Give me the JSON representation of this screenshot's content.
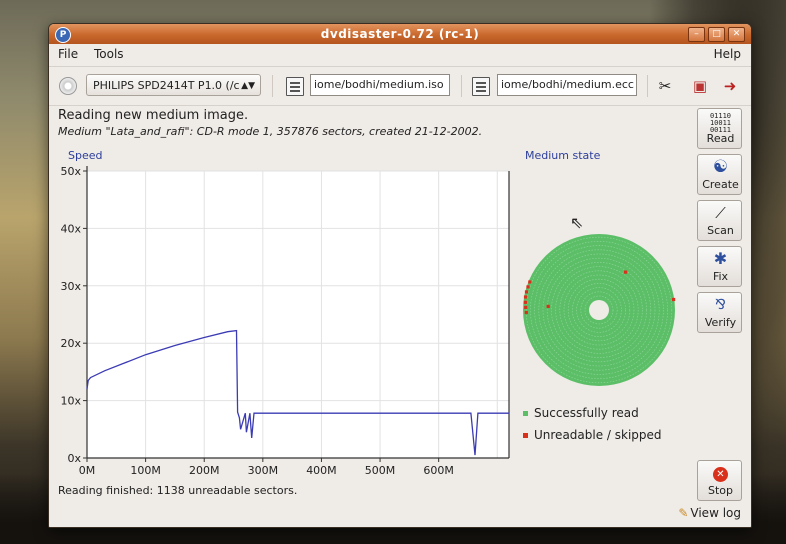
{
  "window": {
    "title": "dvdisaster-0.72 (rc-1)"
  },
  "menu": {
    "file": "File",
    "tools": "Tools",
    "help": "Help"
  },
  "toolbar": {
    "drive": "PHILIPS SPD2414T P1.0 (/c",
    "image_path": "iome/bodhi/medium.iso",
    "ecc_path": "iome/bodhi/medium.ecc"
  },
  "status": {
    "heading": "Reading new medium image.",
    "medium_info": "Medium \"Lata_and_rafi\": CD-R mode 1, 357876 sectors, created 21-12-2002.",
    "finished": "Reading finished: 1138 unreadable sectors."
  },
  "sidebar": {
    "read": "Read",
    "create": "Create",
    "scan": "Scan",
    "fix": "Fix",
    "verify": "Verify",
    "stop": "Stop"
  },
  "bottom": {
    "view_log": "View log"
  },
  "icons": {
    "app": "dvdisaster-icon",
    "drive": "cd-drive-icon",
    "image_file": "image-file-icon",
    "ecc_file": "ecc-file-icon",
    "preferences": "preferences-icon",
    "help": "help-icon",
    "quit": "quit-icon",
    "read": "binary-read-icon",
    "create": "yin-yang-icon",
    "scan": "curve-scan-icon",
    "fix": "puzzle-fix-icon",
    "verify": "checkmark-verify-icon",
    "stop": "stop-icon",
    "log": "log-icon"
  },
  "colors": {
    "speed_line": "#3b3bb5",
    "read_ok": "#5cbf68",
    "unreadable": "#d9301b",
    "axis_label": "#2c3e9b",
    "title_bar": "#c9682c"
  },
  "chart_data": {
    "type": "line",
    "title": "Speed",
    "xlabel": "",
    "ylabel": "",
    "x_unit": "M",
    "xlim": [
      0,
      720
    ],
    "ylim": [
      0,
      50
    ],
    "x_ticks": [
      "0M",
      "100M",
      "200M",
      "300M",
      "400M",
      "500M",
      "600M"
    ],
    "y_ticks": [
      "0x",
      "10x",
      "20x",
      "30x",
      "40x",
      "50x"
    ],
    "grid": true,
    "series": [
      {
        "x": [
          0,
          2,
          6,
          30,
          60,
          100,
          150,
          200,
          240,
          255,
          257,
          260,
          262,
          270,
          272,
          278,
          281,
          285,
          300,
          400,
          500,
          600,
          645,
          655,
          662,
          667,
          674,
          700,
          720
        ],
        "y": [
          12,
          13.5,
          14,
          15.2,
          16.4,
          18,
          19.6,
          21,
          22,
          22.2,
          8,
          7,
          5,
          7.8,
          4.5,
          7.8,
          3.5,
          7.8,
          7.8,
          7.8,
          7.8,
          7.8,
          7.8,
          7.8,
          0.5,
          7.8,
          7.8,
          7.8,
          7.8
        ]
      }
    ]
  },
  "medium_state": {
    "title": "Medium state",
    "legend": [
      {
        "label": "Successfully read",
        "color": "#5cbf68"
      },
      {
        "label": "Unreadable / skipped",
        "color": "#d9301b"
      }
    ],
    "unreadable_marks": [
      {
        "angle_deg": 158,
        "radius": 0.98
      },
      {
        "angle_deg": 162,
        "radius": 0.98
      },
      {
        "angle_deg": 166,
        "radius": 0.98
      },
      {
        "angle_deg": 170,
        "radius": 0.98
      },
      {
        "angle_deg": 174,
        "radius": 0.97
      },
      {
        "angle_deg": 178,
        "radius": 0.96
      },
      {
        "angle_deg": 182,
        "radius": 0.95
      },
      {
        "angle_deg": 176,
        "radius": 0.62
      },
      {
        "angle_deg": 55,
        "radius": 0.55
      },
      {
        "angle_deg": 8,
        "radius": 0.99
      }
    ]
  }
}
